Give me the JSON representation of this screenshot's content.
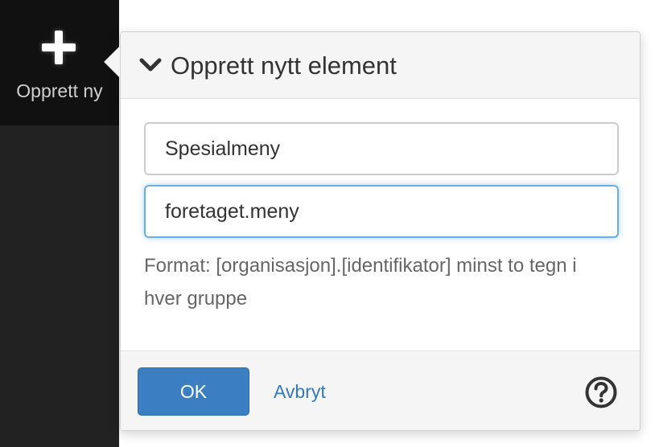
{
  "sidebar": {
    "create_new": {
      "icon": "plus-icon",
      "label": "Opprett ny"
    }
  },
  "popover": {
    "header": {
      "icon": "chevron-down-icon",
      "title": "Opprett nytt element"
    },
    "fields": {
      "name_value": "Spesialmeny",
      "identifier_value": "foretaget.meny"
    },
    "help_text": "Format: [organisasjon].[identifikator] minst to tegn i hver gruppe",
    "footer": {
      "ok_label": "OK",
      "cancel_label": "Avbryt",
      "help_icon": "question-circle-icon"
    }
  },
  "colors": {
    "primary": "#3b7fc2",
    "link": "#337ab7",
    "focus": "#66afe9",
    "sidebar_bg": "#222222"
  }
}
